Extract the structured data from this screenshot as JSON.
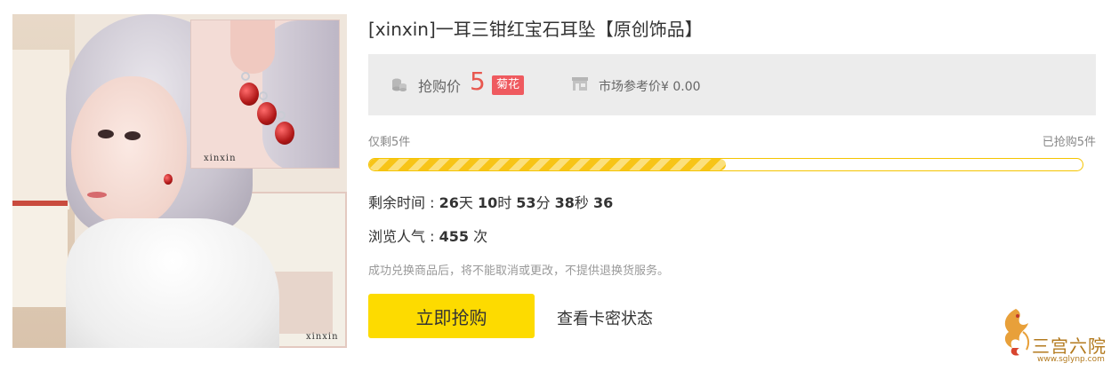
{
  "product": {
    "title": "[xinxin]一耳三钳红宝石耳坠【原创饰品】",
    "image_watermark": "xinxin"
  },
  "price": {
    "label": "抢购价",
    "value": "5",
    "currency_badge": "菊花",
    "market_label": "市场参考价",
    "market_value": "¥ 0.00",
    "price_color": "#e8584f",
    "badge_color": "#ef5a5f"
  },
  "stock": {
    "remaining_label": "仅剩5件",
    "sold_label": "已抢购5件",
    "progress": 0.5
  },
  "countdown": {
    "label": "剩余时间 : ",
    "days": "26",
    "days_unit": "天 ",
    "hours": "10",
    "hours_unit": "时 ",
    "minutes": "53",
    "minutes_unit": "分 ",
    "seconds": "38",
    "seconds_unit": "秒 ",
    "ticks": "36"
  },
  "views": {
    "label": "浏览人气 : ",
    "count": "455",
    "unit": " 次"
  },
  "notice": "成功兑换商品后，将不能取消或更改，不提供退换货服务。",
  "actions": {
    "buy_label": "立即抢购",
    "check_label": "查看卡密状态",
    "buy_color": "#fddb00"
  },
  "logo": {
    "name": "三宫六院",
    "url": "www.sglynp.com"
  }
}
